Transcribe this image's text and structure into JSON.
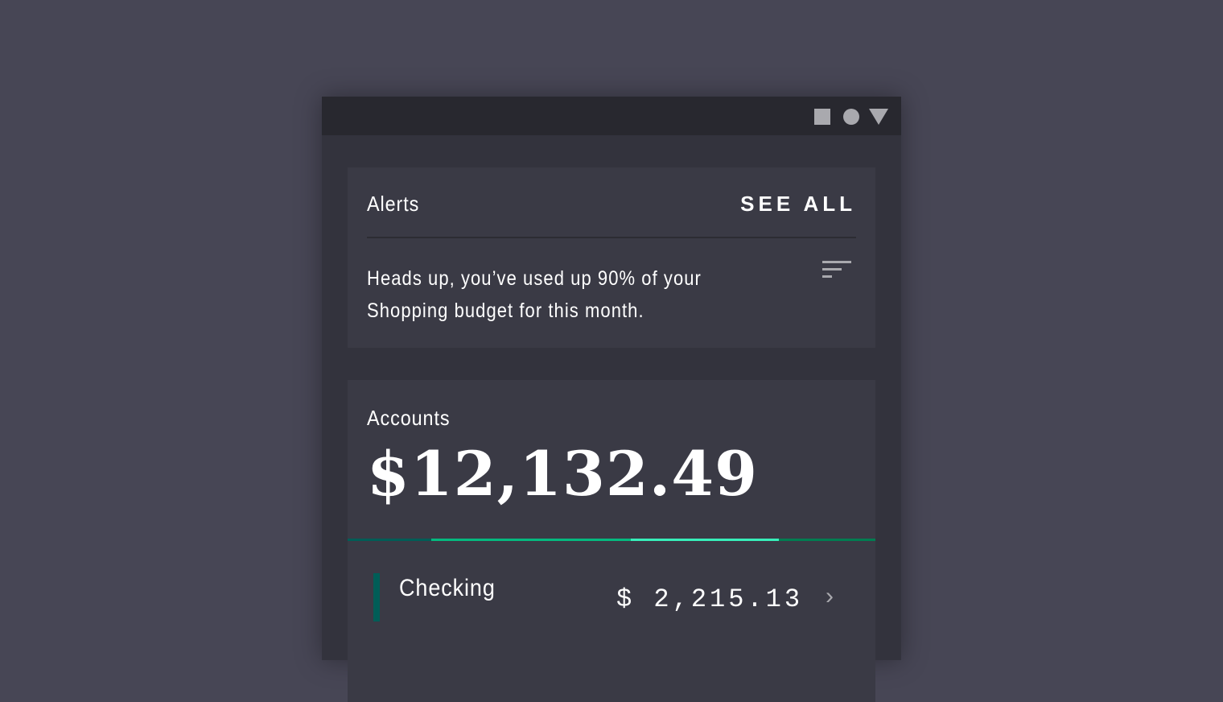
{
  "status_bar": {
    "icons": [
      "square-icon",
      "circle-icon",
      "triangle-icon"
    ]
  },
  "alerts": {
    "title": "Alerts",
    "see_all": "SEE ALL",
    "message": "Heads up, you’ve used up 90% of your Shopping budget for this month.",
    "menu_icon": "sort-icon"
  },
  "accounts": {
    "title": "Accounts",
    "total": "$12,132.49",
    "breakdown": [
      {
        "fraction": 0.159,
        "color": "#005d57"
      },
      {
        "fraction": 0.378,
        "color": "#04b97f"
      },
      {
        "fraction": 0.28,
        "color": "#37efba"
      },
      {
        "fraction": 0.183,
        "color": "#007d51"
      }
    ],
    "items": [
      {
        "name": "Checking",
        "amount": "$ 2,215.13",
        "color": "#005d57"
      }
    ]
  }
}
